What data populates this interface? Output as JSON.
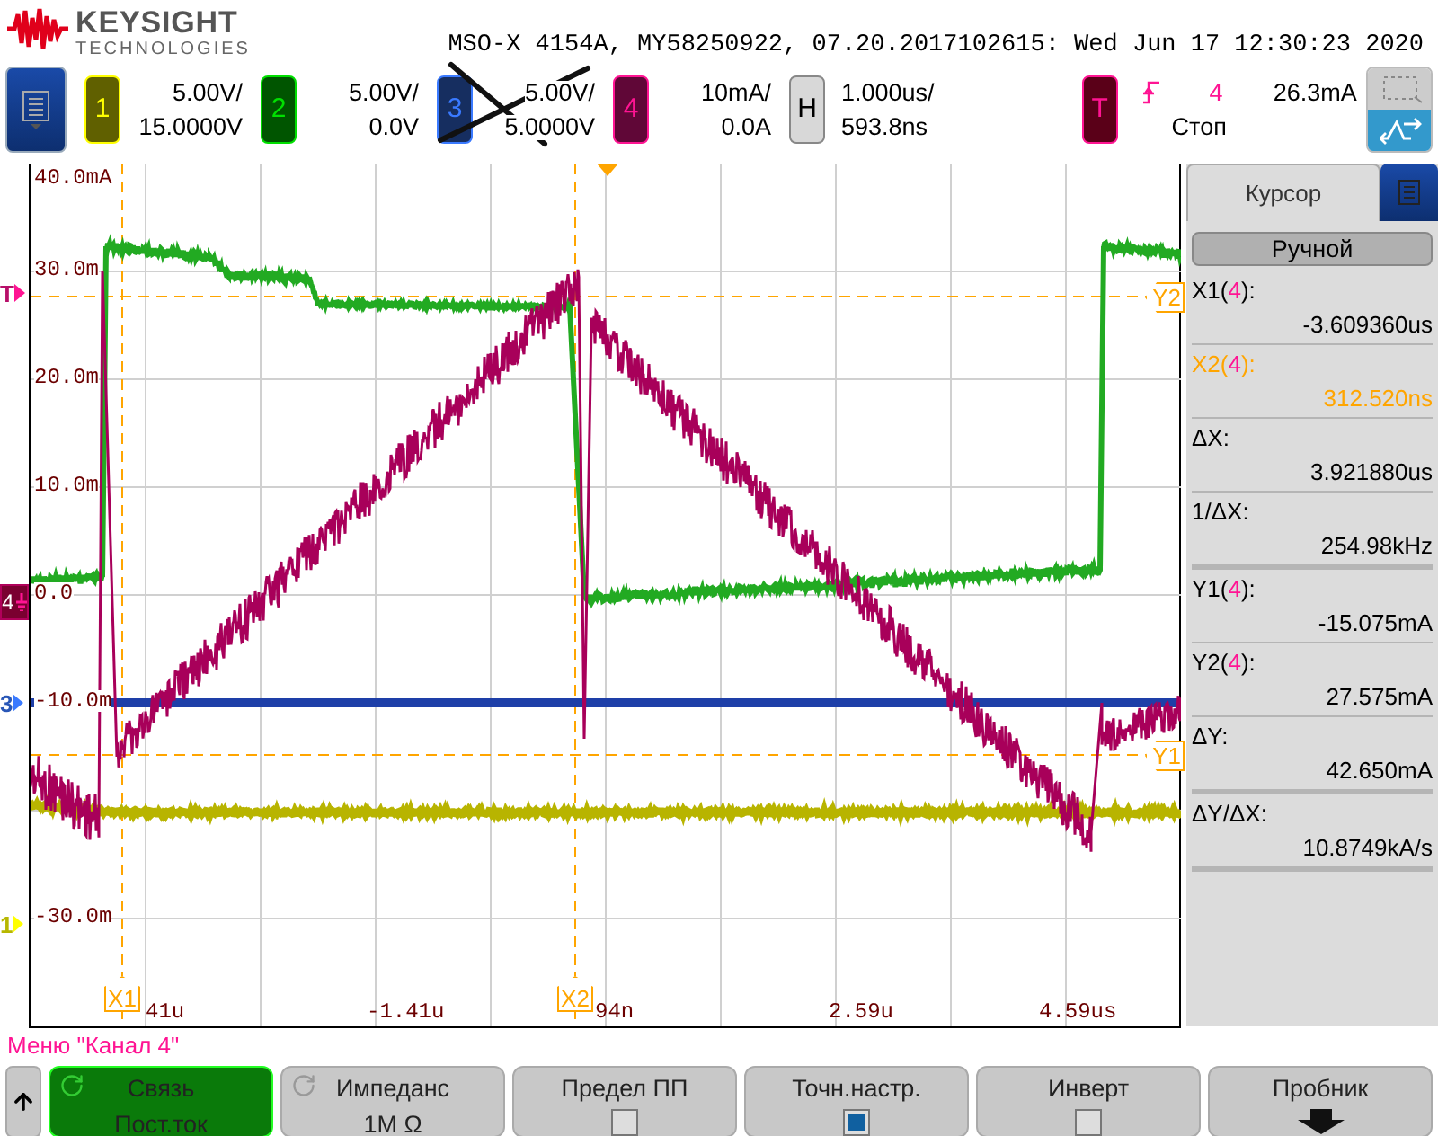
{
  "header": {
    "brand": "KEYSIGHT",
    "brand_sub": "TECHNOLOGIES",
    "title": "MSO-X 4154A, MY58250922, 07.20.2017102615: Wed Jun 17 12:30:23 2020"
  },
  "channels": [
    {
      "number": "1",
      "scale": "5.00V/",
      "offset": "15.0000V",
      "color": "#ffff00",
      "crossed_out": false
    },
    {
      "number": "2",
      "scale": "5.00V/",
      "offset": "0.0V",
      "color": "#00e000",
      "crossed_out": false
    },
    {
      "number": "3",
      "scale": "5.00V/",
      "offset": "5.0000V",
      "color": "#3a7aff",
      "crossed_out": true
    },
    {
      "number": "4",
      "scale": "10mA/",
      "offset": "0.0A",
      "color": "#ff1493",
      "crossed_out": false
    }
  ],
  "horizontal": {
    "label": "H",
    "scale": "1.000us/",
    "delay": "593.8ns"
  },
  "trigger": {
    "label": "T",
    "source": "4",
    "level": "26.3mA",
    "status": "Стоп"
  },
  "scope": {
    "y_labels": [
      "40.0mA",
      "30.0m",
      "20.0m",
      "10.0m",
      "0.0",
      "-10.0m",
      "-30.0m"
    ],
    "x_labels": [
      "41u",
      "-1.41u",
      "94n",
      "2.59u",
      "4.59us"
    ],
    "cursors": [
      {
        "label": "X1",
        "kind": "vertical"
      },
      {
        "label": "X2",
        "kind": "vertical"
      },
      {
        "label": "Y1",
        "kind": "horizontal"
      },
      {
        "label": "Y2",
        "kind": "horizontal"
      }
    ],
    "markers": [
      {
        "label": "T",
        "color": "#ff1493",
        "kind": "arrow"
      },
      {
        "label": "4",
        "color": "#ff1493",
        "kind": "badge"
      },
      {
        "label": "3",
        "color": "#3a7aff",
        "kind": "arrow"
      },
      {
        "label": "1",
        "color": "#ffff00",
        "kind": "arrow"
      }
    ]
  },
  "cursor_panel": {
    "tab": "Курсор",
    "mode": "Ручной",
    "groups": [
      [
        {
          "prefix": "X1(",
          "channel": "4",
          "suffix": "):",
          "value": "-3.609360us",
          "selected": false
        },
        {
          "prefix": "X2(",
          "channel": "4",
          "suffix": "):",
          "value": "312.520ns",
          "selected": true
        },
        {
          "prefix": "ΔX:",
          "value": "3.921880us",
          "selected": false
        },
        {
          "prefix": "1/ΔX:",
          "value": "254.98kHz",
          "selected": false
        }
      ],
      [
        {
          "prefix": "Y1(",
          "channel": "4",
          "suffix": "):",
          "value": "-15.075mA",
          "selected": false
        },
        {
          "prefix": "Y2(",
          "channel": "4",
          "suffix": "):",
          "value": "27.575mA",
          "selected": false
        },
        {
          "prefix": "ΔY:",
          "value": "42.650mA",
          "selected": false
        }
      ],
      [
        {
          "prefix": "ΔY/ΔX:",
          "value": "10.8749kA/s",
          "selected": false
        }
      ]
    ]
  },
  "menu": {
    "title": "Меню \"Канал 4\"",
    "softkeys": [
      {
        "kind": "value",
        "label": "Связь",
        "value": "Пост.ток",
        "selected": true
      },
      {
        "kind": "value",
        "label": "Импеданс",
        "value": "1M Ω",
        "selected": false
      },
      {
        "kind": "checkbox",
        "label": "Предел ПП",
        "checked": false
      },
      {
        "kind": "checkbox",
        "label": "Точн.настр.",
        "checked": true
      },
      {
        "kind": "checkbox",
        "label": "Инверт",
        "checked": false
      },
      {
        "kind": "submenu",
        "label": "Пробник"
      }
    ]
  }
}
